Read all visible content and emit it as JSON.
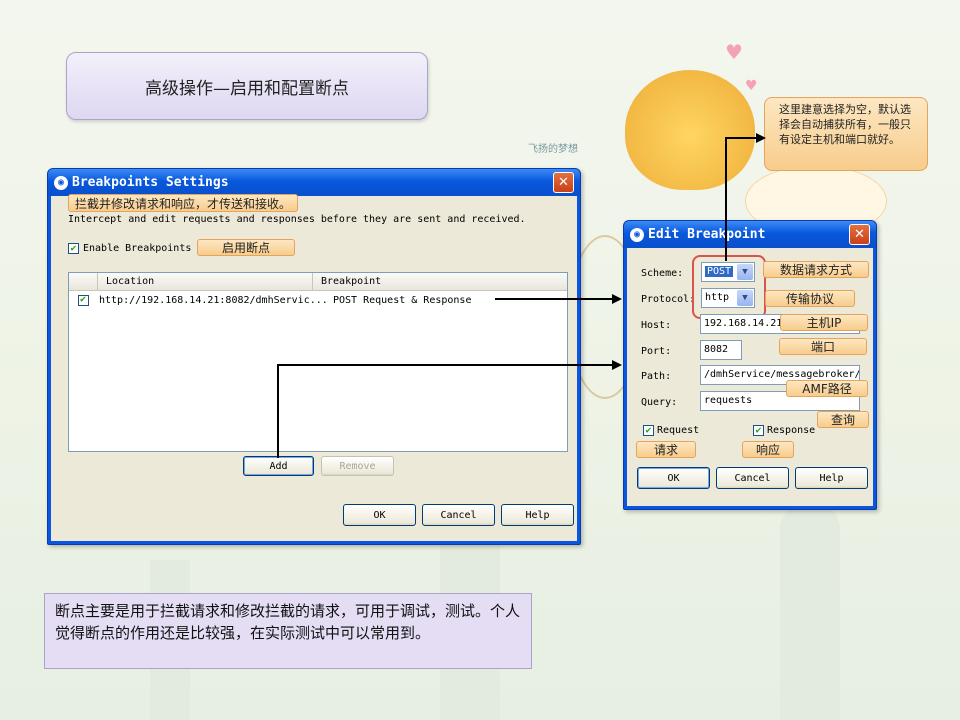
{
  "slide": {
    "title": "高级操作—启用和配置断点",
    "summary": "断点主要是用于拦截请求和修改拦截的请求，可用于调试，测试。个人觉得断点的作用还是比较强，在实际测试中可以常用到。"
  },
  "background": {
    "text_1": "飞扬的梦想",
    "icon": "cartoon-cat-icon"
  },
  "breakpoints_dialog": {
    "title": "Breakpoints Settings",
    "note_intercept": "拦截并修改请求和响应，才传送和接收。",
    "description": "Intercept and edit requests and responses before they are sent and received.",
    "enable_label": "Enable Breakpoints",
    "enable_checked": true,
    "note_enable": "启用断点",
    "columns": [
      "Location",
      "Breakpoint"
    ],
    "rows": [
      {
        "checked": true,
        "location": "http://192.168.14.21:8082/dmhServic...",
        "breakpoint": "POST Request & Response"
      }
    ],
    "add_label": "Add",
    "remove_label": "Remove",
    "ok_label": "OK",
    "cancel_label": "Cancel",
    "help_label": "Help"
  },
  "edit_dialog": {
    "title": "Edit Breakpoint",
    "scheme_label": "Scheme:",
    "scheme_value": "POST",
    "protocol_label": "Protocol:",
    "protocol_value": "http",
    "host_label": "Host:",
    "host_value": "192.168.14.21",
    "port_label": "Port:",
    "port_value": "8082",
    "path_label": "Path:",
    "path_value": "/dmhService/messagebroker/",
    "query_label": "Query:",
    "query_value": "requests",
    "request_label": "Request",
    "response_label": "Response",
    "ok_label": "OK",
    "cancel_label": "Cancel",
    "help_label": "Help",
    "notes": {
      "scheme": "数据请求方式",
      "protocol": "传输协议",
      "host": "主机IP",
      "port": "端口",
      "path": "AMF路径",
      "query": "查询",
      "request": "请求",
      "response": "响应"
    }
  },
  "callout": "这里建意选择为空，默认选择会自动捕获所有，一般只有设定主机和端口就好。",
  "colors": {
    "title_bar": "#0a56e0",
    "dialog_bg": "#ece9d8",
    "note_bg": "#f8cc8c",
    "highlight_border": "#d9534f"
  }
}
